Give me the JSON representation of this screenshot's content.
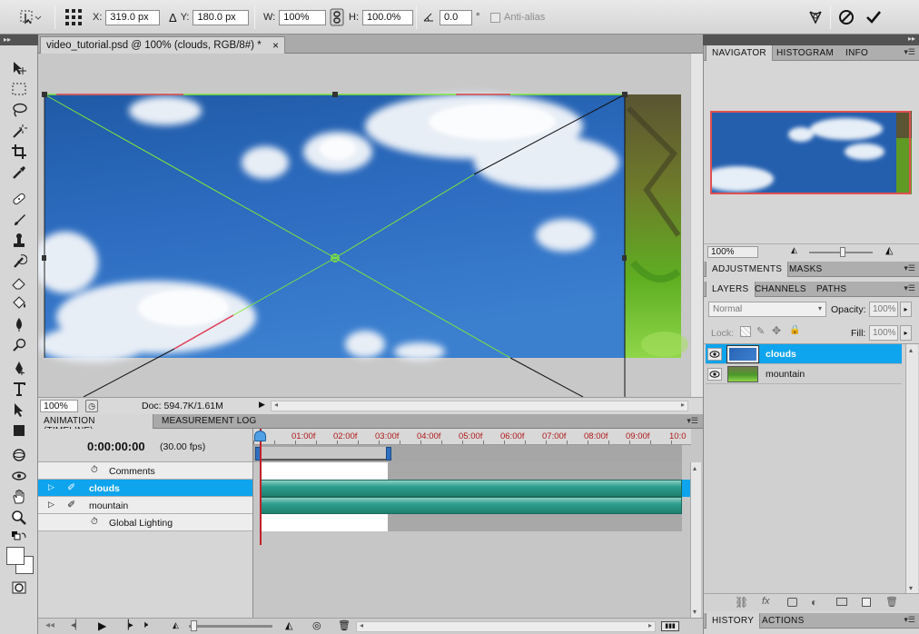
{
  "options_bar": {
    "x_label": "X:",
    "x_value": "319.0 px",
    "y_label": "Y:",
    "y_value": "180.0 px",
    "w_label": "W:",
    "w_value": "100%",
    "h_label": "H:",
    "h_value": "100.0%",
    "angle_value": "0.0",
    "degree_symbol": "°",
    "antialias_label": "Anti-alias"
  },
  "document": {
    "tab_title": "video_tutorial.psd @ 100% (clouds, RGB/8#) *",
    "close_symbol": "×",
    "zoom": "100%",
    "doc_info": "Doc: 594.7K/1.61M"
  },
  "animation_panel": {
    "tabs": [
      "ANIMATION (TIMELINE)",
      "MEASUREMENT LOG"
    ],
    "timecode": "0:00:00:00",
    "fps": "(30.00 fps)",
    "ruler_labels": [
      "01:00f",
      "02:00f",
      "03:00f",
      "04:00f",
      "05:00f",
      "06:00f",
      "07:00f",
      "08:00f",
      "09:00f",
      "10:0"
    ],
    "rows": [
      {
        "label": "Comments",
        "type": "property"
      },
      {
        "label": "clouds",
        "type": "layer",
        "selected": true
      },
      {
        "label": "mountain",
        "type": "layer",
        "selected": false
      },
      {
        "label": "Global Lighting",
        "type": "property"
      }
    ]
  },
  "navigator_panel": {
    "tabs": [
      "NAVIGATOR",
      "HISTOGRAM",
      "INFO"
    ],
    "zoom": "100%"
  },
  "adjustments_panel": {
    "tabs": [
      "ADJUSTMENTS",
      "MASKS"
    ]
  },
  "layers_panel": {
    "tabs": [
      "LAYERS",
      "CHANNELS",
      "PATHS"
    ],
    "blend_mode": "Normal",
    "opacity_label": "Opacity:",
    "opacity_value": "100%",
    "lock_label": "Lock:",
    "fill_label": "Fill:",
    "fill_value": "100%",
    "layers": [
      {
        "name": "clouds",
        "selected": true
      },
      {
        "name": "mountain",
        "selected": false
      }
    ]
  },
  "history_panel": {
    "tabs": [
      "HISTORY",
      "ACTIONS"
    ]
  },
  "colors": {
    "selection_blue": "#0ea4ee",
    "timeline_red": "#c0392b",
    "transform_green": "#7fe63a",
    "navigator_frame": "#e05050"
  }
}
